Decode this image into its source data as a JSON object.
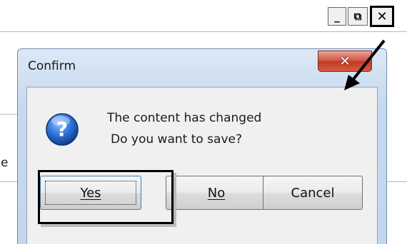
{
  "window_controls": {
    "minimize_glyph": "_",
    "restore_glyph": "⧉",
    "close_glyph": "✕"
  },
  "background": {
    "partial_char": "e"
  },
  "dialog": {
    "title": "Confirm",
    "close_glyph": "✕",
    "icon": "question-icon",
    "message_line1": "The content has changed",
    "message_line2": "Do you want to save?",
    "buttons": {
      "yes": "Yes",
      "no": "No",
      "cancel": "Cancel"
    }
  },
  "colors": {
    "dialog_frame": "#c3d6ec",
    "close_button": "#c23a24",
    "icon_blue": "#1f5fb8"
  }
}
